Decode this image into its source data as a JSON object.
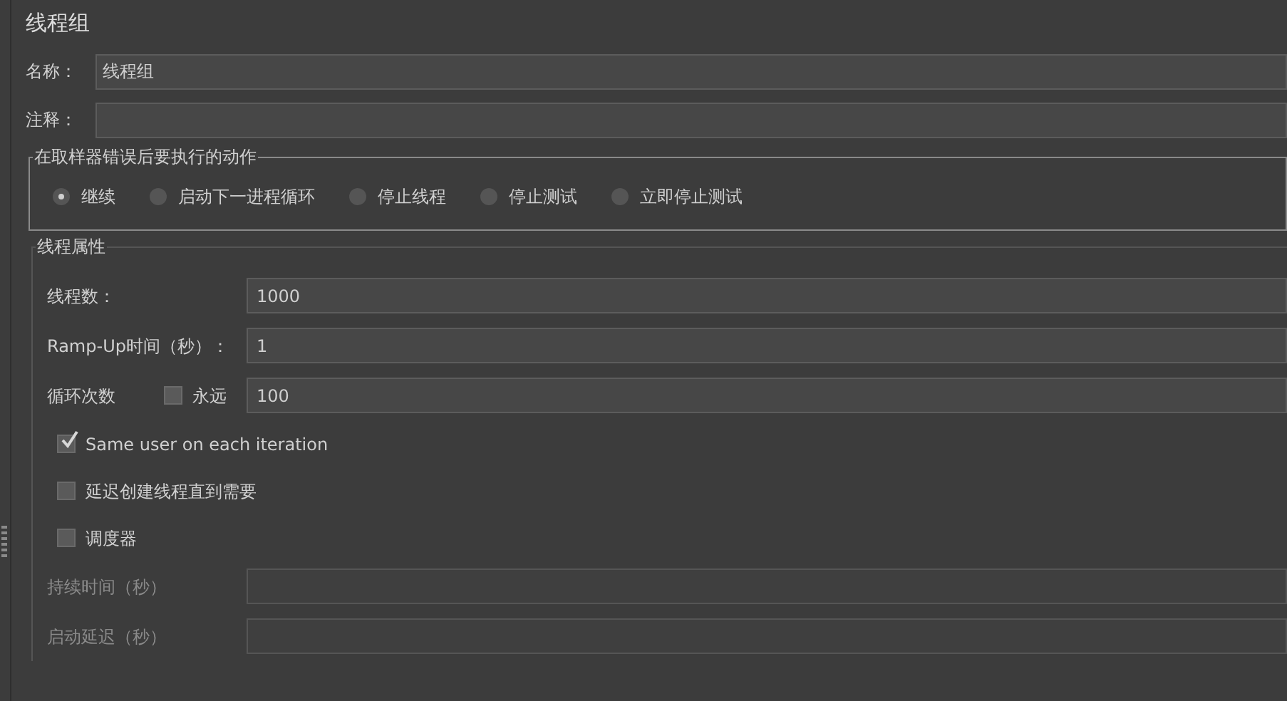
{
  "title": "线程组",
  "name_field": {
    "label": "名称：",
    "value": "线程组"
  },
  "comment_field": {
    "label": "注释："
  },
  "error_action": {
    "title": "在取样器错误后要执行的动作",
    "options": [
      {
        "label": "继续",
        "selected": true
      },
      {
        "label": "启动下一进程循环",
        "selected": false
      },
      {
        "label": "停止线程",
        "selected": false
      },
      {
        "label": "停止测试",
        "selected": false
      },
      {
        "label": "立即停止测试",
        "selected": false
      }
    ]
  },
  "thread_properties": {
    "title": "线程属性",
    "fields": [
      {
        "kind": "text",
        "label": "线程数：",
        "value": "1000",
        "disabled": false
      },
      {
        "kind": "text",
        "label": "Ramp-Up时间（秒）：",
        "value": "1",
        "disabled": false
      },
      {
        "kind": "loop",
        "label": "循环次数",
        "forever": {
          "label": "永远",
          "checked": false
        },
        "value": "100",
        "disabled": false
      }
    ],
    "checkboxes": [
      {
        "label": "Same user on each iteration",
        "checked": true
      },
      {
        "label": "延迟创建线程直到需要",
        "checked": false
      },
      {
        "label": "调度器",
        "checked": false
      }
    ],
    "scheduler_fields": [
      {
        "label": "持续时间（秒）",
        "disabled": true
      },
      {
        "label": "启动延迟（秒）",
        "disabled": true
      }
    ]
  }
}
